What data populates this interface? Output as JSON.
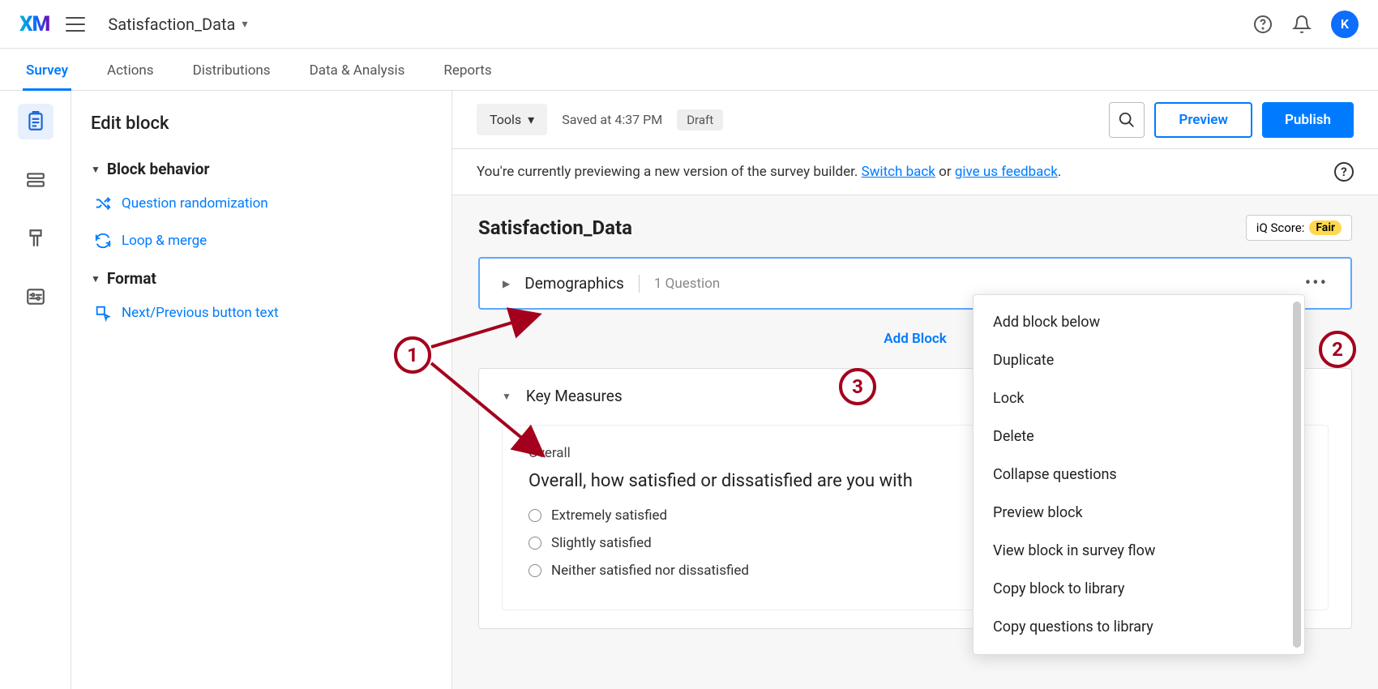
{
  "header": {
    "logo": "XM",
    "project_name": "Satisfaction_Data",
    "avatar_initial": "K"
  },
  "tabs": {
    "items": [
      "Survey",
      "Actions",
      "Distributions",
      "Data & Analysis",
      "Reports"
    ],
    "active": 0
  },
  "edit_panel": {
    "title": "Edit block",
    "section1": "Block behavior",
    "opt_randomization": "Question randomization",
    "opt_loop": "Loop & merge",
    "section2": "Format",
    "opt_buttons": "Next/Previous button text"
  },
  "toolbar": {
    "tools_label": "Tools",
    "saved_text": "Saved at 4:37 PM",
    "draft_label": "Draft",
    "preview_label": "Preview",
    "publish_label": "Publish"
  },
  "notice": {
    "prefix": "You're currently previewing a new version of the survey builder. ",
    "link1": "Switch back",
    "middle": " or ",
    "link2": "give us feedback",
    "suffix": "."
  },
  "survey": {
    "title": "Satisfaction_Data",
    "iq_label": "iQ Score:",
    "iq_value": "Fair",
    "block1": {
      "name": "Demographics",
      "count": "1 Question"
    },
    "add_block": "Add Block",
    "block2": {
      "name": "Key Measures"
    },
    "question": {
      "label": "Overall",
      "text": "Overall, how satisfied or dissatisfied are you with",
      "options": [
        "Extremely satisfied",
        "Slightly satisfied",
        "Neither satisfied nor dissatisfied"
      ]
    }
  },
  "ctx_menu": {
    "items": [
      "Add block below",
      "Duplicate",
      "Lock",
      "Delete",
      "Collapse questions",
      "Preview block",
      "View block in survey flow",
      "Copy block to library",
      "Copy questions to library"
    ]
  },
  "annotations": {
    "a1": "1",
    "a2": "2",
    "a3": "3"
  }
}
